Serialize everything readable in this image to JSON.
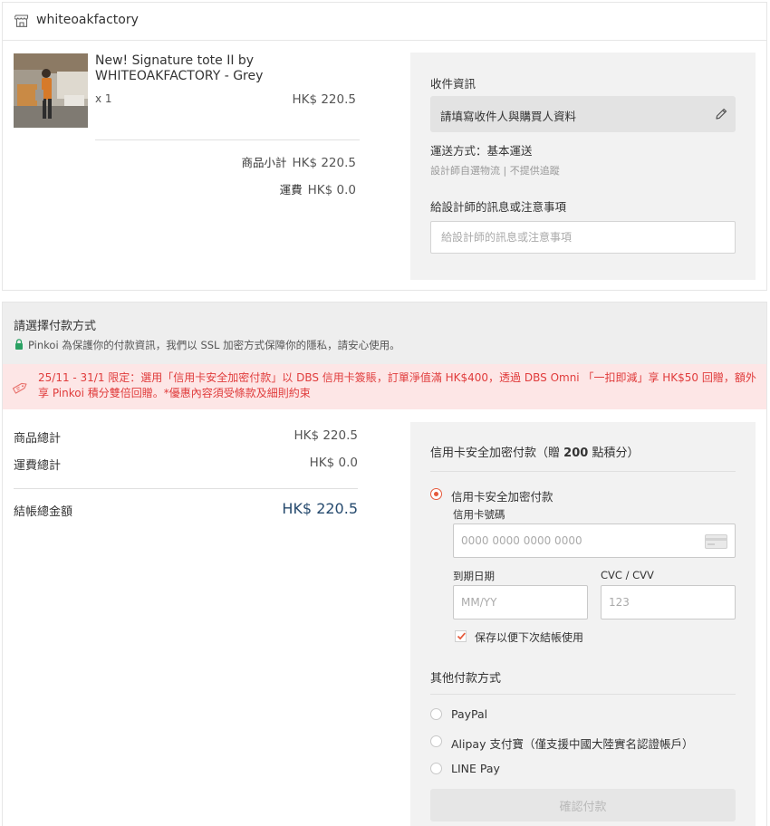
{
  "shop": {
    "name": "whiteoakfactory",
    "icon": "store-icon"
  },
  "product": {
    "name": "New! Signature tote II by WHITEOAKFACTORY - Grey",
    "quantity": "x 1",
    "price": "HK$ 220.5",
    "image": "product-photo"
  },
  "summary": {
    "subtotal_label": "商品小計",
    "subtotal_value": "HK$ 220.5",
    "shipping_label": "運費",
    "shipping_value": "HK$ 0.0"
  },
  "receiver": {
    "title": "收件資訊",
    "fill_button": "請填寫收件人與購買人資料",
    "shipping_method": "運送方式：基本運送",
    "shipping_note": "設計師自選物流 | 不提供追蹤",
    "message_title": "給設計師的訊息或注意事項",
    "message_placeholder": "給設計師的訊息或注意事項"
  },
  "payment": {
    "title": "請選擇付款方式",
    "secure_note": "Pinkoi 為保護你的付款資訊，我們以 SSL 加密方式保障你的隱私，請安心使用。",
    "promo": "25/11 - 31/1 限定：選用「信用卡安全加密付款」以 DBS 信用卡簽賬，訂單淨值滿 HK$400，透過 DBS Omni 「一扣即減」享 HK$50 回贈，額外享 Pinkoi 積分雙倍回贈。*優惠內容須受條款及細則約束",
    "colors": {
      "accent": "#e5593b",
      "promo_text": "#e03c3c",
      "promo_bg": "#fde6e6",
      "total": "#264a6e"
    }
  },
  "totals": {
    "goods_label": "商品總計",
    "goods_value": "HK$ 220.5",
    "shipping_label": "運費總計",
    "shipping_value": "HK$ 0.0",
    "grand_label": "結帳總金額",
    "grand_value": "HK$ 220.5"
  },
  "credit_card": {
    "section_prefix": "信用卡安全加密付款（贈",
    "section_points": "200",
    "section_suffix": "點積分）",
    "option_label": "信用卡安全加密付款",
    "selected": true,
    "number_label": "信用卡號碼",
    "number_placeholder": "0000 0000 0000 0000",
    "expiry_label": "到期日期",
    "expiry_placeholder": "MM/YY",
    "cvc_label": "CVC / CVV",
    "cvc_placeholder": "123",
    "save_label": "保存以便下次結帳使用",
    "save_checked": true
  },
  "other_methods": {
    "title": "其他付款方式",
    "options": [
      "PayPal",
      "Alipay 支付寶（僅支援中國大陸實名認證帳戶）",
      "LINE Pay"
    ]
  },
  "confirm_button": "確認付款"
}
